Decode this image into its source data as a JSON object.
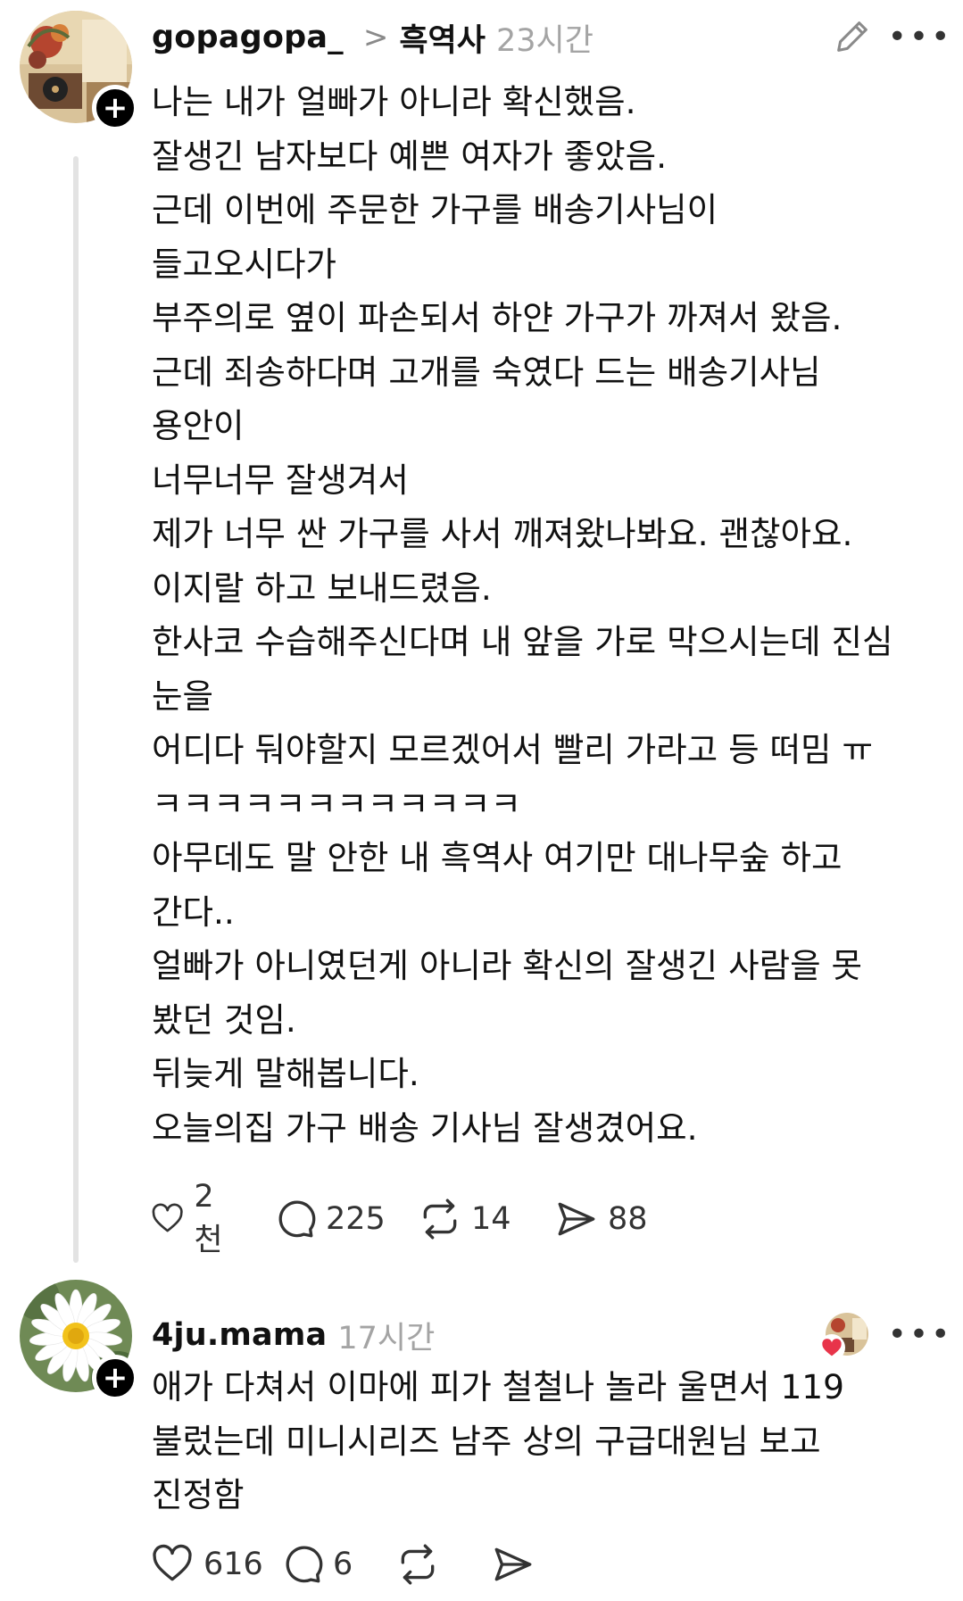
{
  "posts": [
    {
      "username": "gopagopa_",
      "topic_chevron": ">",
      "topic": "흑역사",
      "time": "23시간",
      "follow_symbol": "+",
      "more_label": "•••",
      "lines": [
        "나는 내가 얼빠가 아니라 확신했음.",
        "잘생긴 남자보다 예쁜 여자가 좋았음.",
        "근데 이번에 주문한 가구를 배송기사님이",
        "들고오시다가",
        "부주의로 옆이 파손되서 하얀 가구가 까져서 왔음.",
        "근데 죄송하다며 고개를 숙였다 드는 배송기사님",
        "용안이",
        "너무너무 잘생겨서",
        "제가 너무 싼 가구를 사서 깨져왔나봐요. 괜찮아요.",
        "이지랄 하고 보내드렸음.",
        "한사코 수습해주신다며 내 앞을 가로 막으시는데 진심",
        "눈을",
        "어디다 둬야할지 모르겠어서 빨리 가라고 등 떠밈 ㅠ",
        "ㅋㅋㅋㅋㅋㅋㅋㅋㅋㅋㅋㅋ",
        "아무데도 말 안한 내 흑역사 여기만 대나무숲 하고",
        "간다..",
        "얼빠가 아니였던게 아니라 확신의 잘생긴 사람을 못",
        "봤던 것임.",
        "뒤늦게 말해봅니다.",
        "오늘의집 가구 배송 기사님 잘생겼어요."
      ],
      "likes": "2천",
      "comments": "225",
      "reposts": "14",
      "shares": "88"
    },
    {
      "username": "4ju.mama",
      "time": "17시간",
      "follow_symbol": "+",
      "more_label": "•••",
      "lines": [
        "애가 다쳐서 이마에 피가 철철나 놀라 울면서 119",
        "불렀는데 미니시리즈 남주 상의 구급대원님 보고",
        "진정함"
      ],
      "likes": "616",
      "comments": "6"
    }
  ],
  "colors": {
    "text": "#111111",
    "muted": "#a4a4a4",
    "thread_line": "#e3e3e3",
    "heart_red": "#e8344a"
  },
  "icons": [
    "edit-icon",
    "more-icon",
    "heart-icon",
    "comment-icon",
    "repost-icon",
    "share-icon",
    "liked-by-heart-icon"
  ]
}
